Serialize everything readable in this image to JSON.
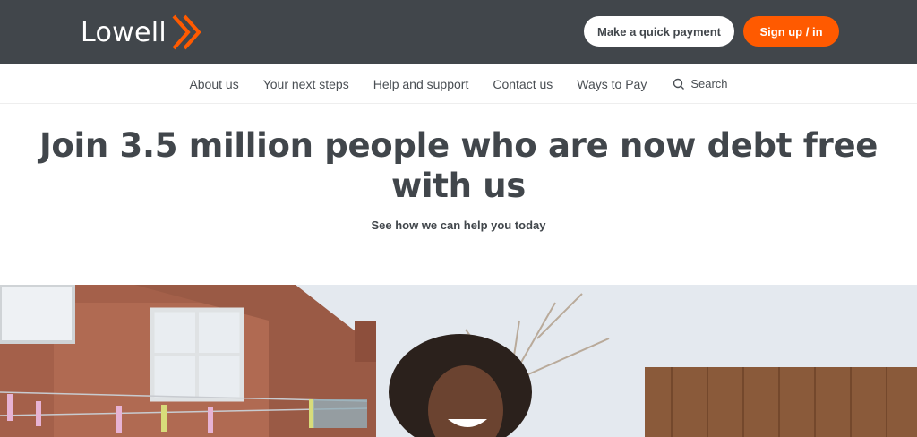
{
  "header": {
    "logo_text": "Lowell",
    "logo_mark": "double-chevron-right-icon",
    "pay_button": "Make a quick payment",
    "signin_button": "Sign up / in",
    "colors": {
      "bar": "#41464b",
      "accent": "#ff5a00"
    }
  },
  "nav": {
    "items": [
      {
        "label": "About us"
      },
      {
        "label": "Your next steps"
      },
      {
        "label": "Help and support"
      },
      {
        "label": "Contact us"
      },
      {
        "label": "Ways to Pay"
      }
    ],
    "search_label": "Search",
    "search_icon": "search-icon"
  },
  "hero": {
    "title_line1": "Join 3.5 million people who are now debt free",
    "title_line2": "with us",
    "subtitle": "See how we can help you today"
  },
  "photo": {
    "description_icon": "hero-photo"
  }
}
